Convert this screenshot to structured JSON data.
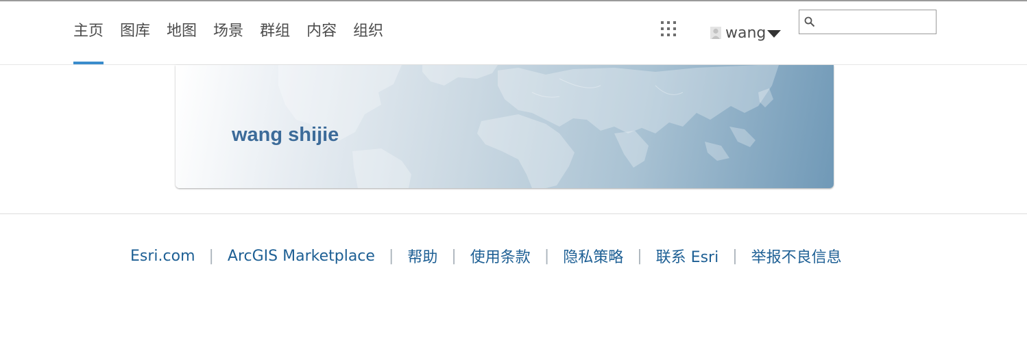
{
  "nav": {
    "items": [
      "主页",
      "图库",
      "地图",
      "场景",
      "群组",
      "内容",
      "组织"
    ],
    "active": "主页"
  },
  "header": {
    "apps_icon": "apps-grid-icon",
    "user": {
      "name": "wang",
      "avatar_icon": "user-avatar-icon",
      "caret_icon": "caret-down-icon"
    },
    "search": {
      "placeholder": "",
      "value": "",
      "icon": "search-icon"
    }
  },
  "banner": {
    "full_name": "wang shijie"
  },
  "footer": {
    "links": [
      "Esri.com",
      "ArcGIS Marketplace",
      "帮助",
      "使用条款",
      "隐私策略",
      "联系 Esri",
      "举报不良信息"
    ],
    "separator": "|"
  },
  "colors": {
    "nav_active_underline": "#3a8ccc",
    "banner_name": "#3c6b99",
    "footer_link": "#1d5f94"
  }
}
